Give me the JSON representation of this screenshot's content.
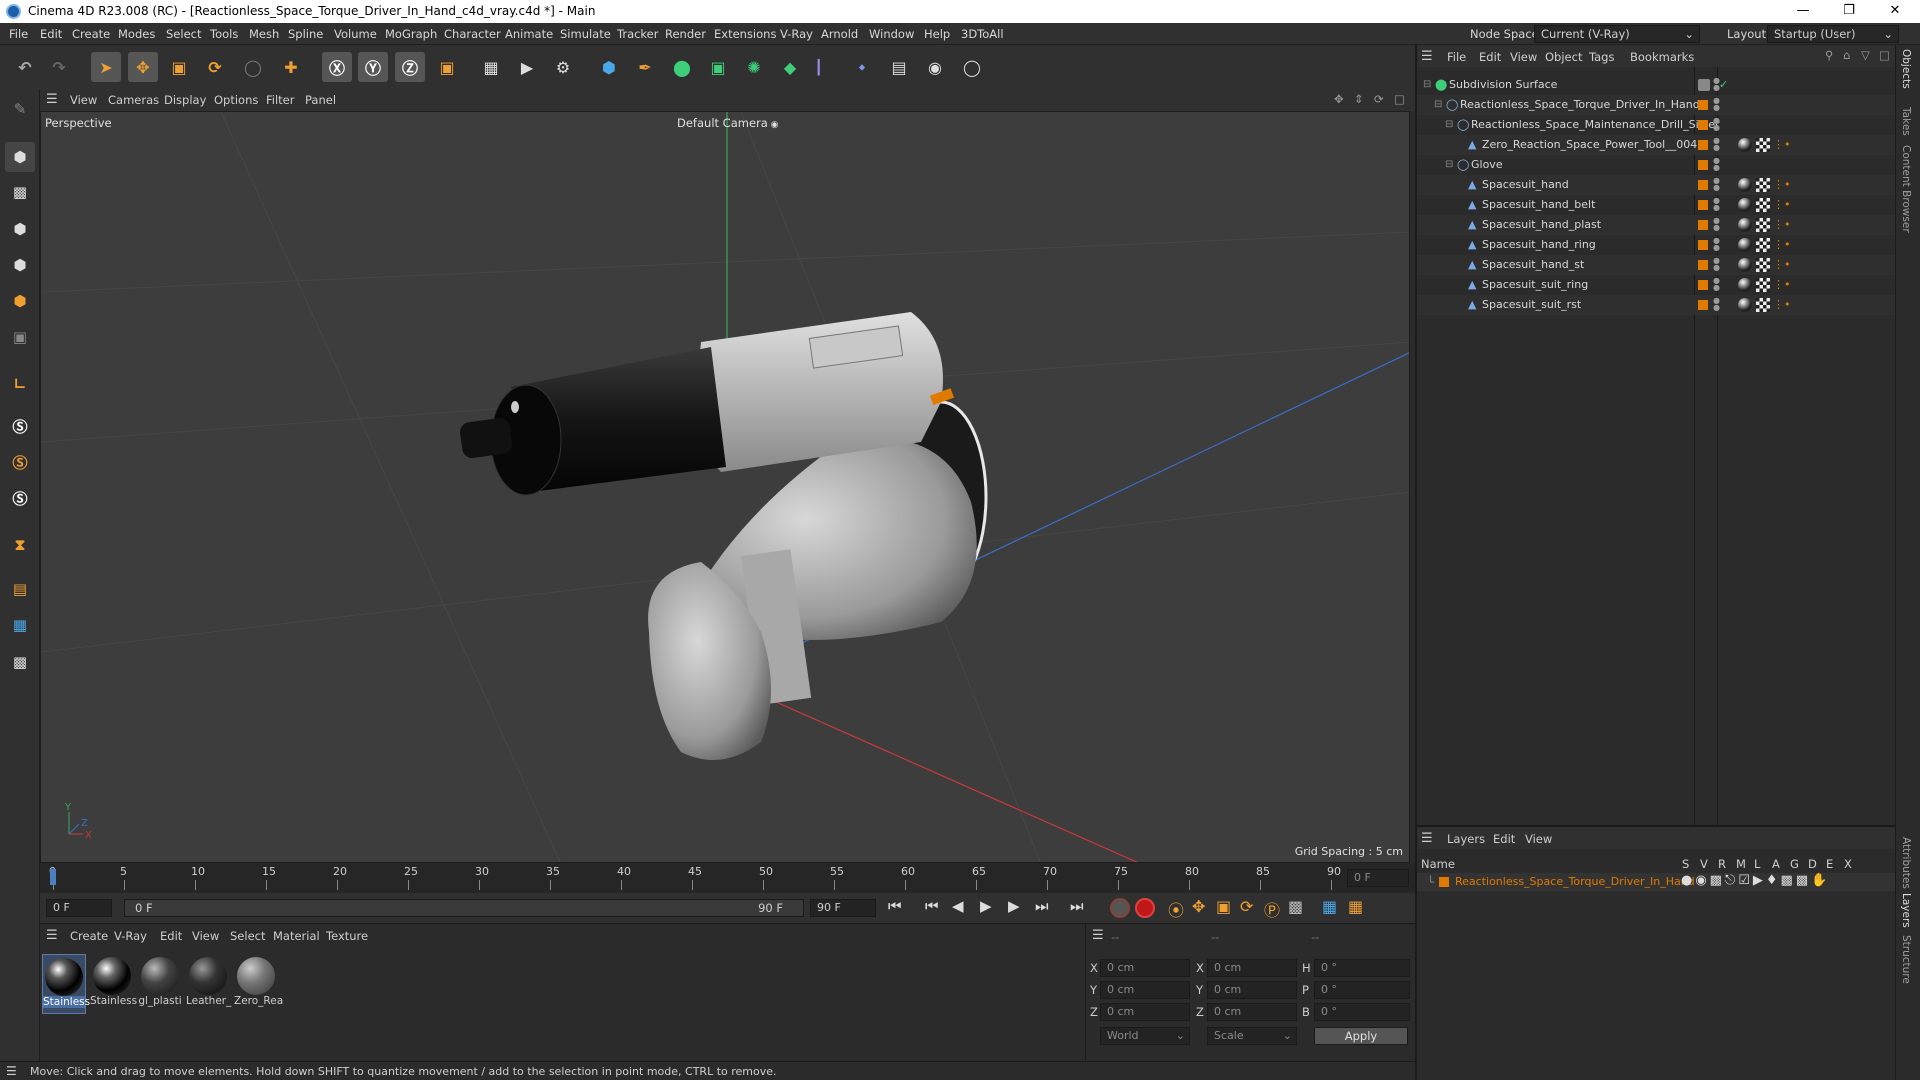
{
  "window": {
    "title": "Cinema 4D R23.008 (RC) - [Reactionless_Space_Torque_Driver_In_Hand_c4d_vray.c4d *] - Main"
  },
  "menubar": {
    "items": [
      "File",
      "Edit",
      "Create",
      "Modes",
      "Select",
      "Tools",
      "Mesh",
      "Spline",
      "Volume",
      "MoGraph",
      "Character",
      "Animate",
      "Simulate",
      "Tracker",
      "Render",
      "Extensions",
      "V-Ray",
      "Arnold",
      "Window",
      "Help",
      "3DToAll"
    ],
    "node_space_label": "Node Space:",
    "node_space_value": "Current (V-Ray)",
    "layout_label": "Layout:",
    "layout_value": "Startup (User)"
  },
  "viewport": {
    "menu": [
      "View",
      "Cameras",
      "Display",
      "Options",
      "Filter",
      "Panel"
    ],
    "name": "Perspective",
    "camera": "Default Camera",
    "grid_spacing": "Grid Spacing : 5 cm"
  },
  "timeline": {
    "ticks": [
      "0",
      "5",
      "10",
      "15",
      "20",
      "25",
      "30",
      "35",
      "40",
      "45",
      "50",
      "55",
      "60",
      "65",
      "70",
      "75",
      "80",
      "85",
      "90"
    ],
    "current_frame": "0 F"
  },
  "playbar": {
    "start": "0 F",
    "range_start": "0 F",
    "range_end": "90 F",
    "end": "90 F"
  },
  "materials": {
    "menu": [
      "Create",
      "V-Ray",
      "Edit",
      "View",
      "Select",
      "Material",
      "Texture"
    ],
    "items": [
      "Stainless",
      "Stainless",
      "gl_plasti",
      "Leather_",
      "Zero_Rea"
    ]
  },
  "coords": {
    "header": [
      "--",
      "--",
      "--"
    ],
    "rows": [
      {
        "a": "X",
        "av": "0 cm",
        "b": "X",
        "bv": "0 cm",
        "c": "H",
        "cv": "0 °"
      },
      {
        "a": "Y",
        "av": "0 cm",
        "b": "Y",
        "bv": "0 cm",
        "c": "P",
        "cv": "0 °"
      },
      {
        "a": "Z",
        "av": "0 cm",
        "b": "Z",
        "bv": "0 cm",
        "c": "B",
        "cv": "0 °"
      }
    ],
    "world": "World",
    "scale": "Scale",
    "apply": "Apply"
  },
  "statusbar": {
    "text": "Move: Click and drag to move elements. Hold down SHIFT to quantize movement / add to the selection in point mode, CTRL to remove."
  },
  "objects": {
    "menu": [
      "File",
      "Edit",
      "View",
      "Object",
      "Tags",
      "Bookmarks"
    ],
    "rows": [
      {
        "name": "Subdivision Surface",
        "level": 0,
        "type": "subdiv"
      },
      {
        "name": "Reactionless_Space_Torque_Driver_In_Hand",
        "level": 1,
        "type": "null"
      },
      {
        "name": "Reactionless_Space_Maintenance_Drill_Silver",
        "level": 2,
        "type": "null"
      },
      {
        "name": "Zero_Reaction_Space_Power_Tool__004",
        "level": 3,
        "type": "poly"
      },
      {
        "name": "Glove",
        "level": 2,
        "type": "null"
      },
      {
        "name": "Spacesuit_hand",
        "level": 3,
        "type": "poly"
      },
      {
        "name": "Spacesuit_hand_belt",
        "level": 3,
        "type": "poly"
      },
      {
        "name": "Spacesuit_hand_plast",
        "level": 3,
        "type": "poly"
      },
      {
        "name": "Spacesuit_hand_ring",
        "level": 3,
        "type": "poly"
      },
      {
        "name": "Spacesuit_hand_st",
        "level": 3,
        "type": "poly"
      },
      {
        "name": "Spacesuit_suit_ring",
        "level": 3,
        "type": "poly"
      },
      {
        "name": "Spacesuit_suit_rst",
        "level": 3,
        "type": "poly"
      }
    ]
  },
  "layers": {
    "menu": [
      "Layers",
      "Edit",
      "View"
    ],
    "name_header": "Name",
    "cols": [
      "S",
      "V",
      "R",
      "M",
      "L",
      "A",
      "G",
      "D",
      "E",
      "X"
    ],
    "layer_name": "Reactionless_Space_Torque_Driver_In_Hand"
  },
  "right_tabs": [
    "Objects",
    "Takes",
    "Content Browser",
    "Attributes",
    "Layers",
    "Structure"
  ],
  "colors": {
    "accent": "#e07b00",
    "selected_blue": "#4a6fa5"
  }
}
